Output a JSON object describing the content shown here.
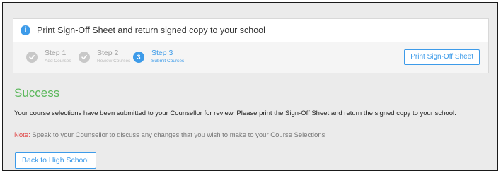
{
  "header": {
    "info_icon": "i",
    "title": "Print Sign-Off Sheet and return signed copy to your school"
  },
  "steps": [
    {
      "name": "Step 1",
      "sub": "Add Courses",
      "state": "done"
    },
    {
      "name": "Step 2",
      "sub": "Review Courses",
      "state": "done"
    },
    {
      "name": "Step 3",
      "sub": "Submit Courses",
      "state": "current",
      "number": "3"
    }
  ],
  "toolbar": {
    "print_label": "Print Sign-Off Sheet"
  },
  "result": {
    "title": "Success",
    "message": "Your course selections have been submitted to your Counsellor for review. Please print the Sign-Off Sheet and return the signed copy to your school.",
    "note_label": "Note:",
    "note_text": " Speak to your Counsellor to discuss any changes that you wish to make to your Course Selections"
  },
  "actions": {
    "back_label": "Back to High School"
  },
  "colors": {
    "accent": "#3d9be9",
    "success": "#5cb85c",
    "note": "#e04343"
  }
}
